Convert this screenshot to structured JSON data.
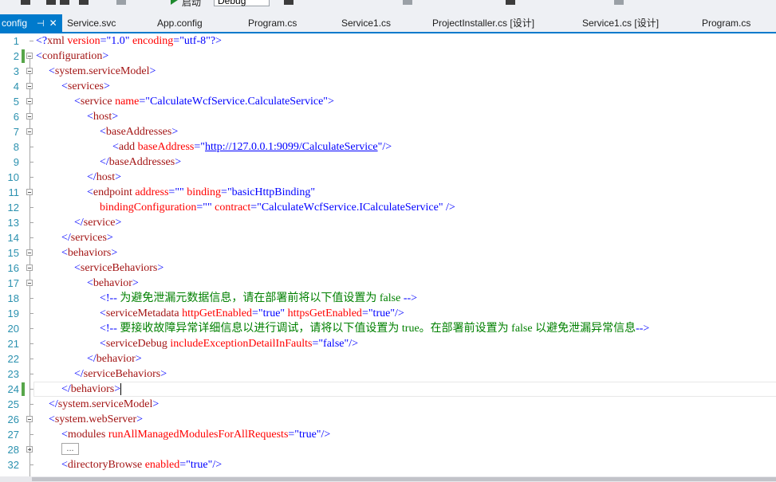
{
  "toolbar": {
    "start_label": "启动",
    "config_value": "Debug"
  },
  "tabs": [
    {
      "label": "config",
      "active": true,
      "pin": "⊣",
      "close": "✕"
    },
    {
      "label": "Service.svc"
    },
    {
      "label": "App.config"
    },
    {
      "label": "Program.cs"
    },
    {
      "label": "Service1.cs"
    },
    {
      "label": "ProjectInstaller.cs [设计]"
    },
    {
      "label": "Service1.cs [设计]"
    },
    {
      "label": "Program.cs"
    }
  ],
  "collapsed_label": "...",
  "lines": [
    {
      "no": "1",
      "indent": 0,
      "tokens": [
        [
          "b",
          "<?"
        ],
        [
          "m",
          "xml"
        ],
        [
          "r",
          " version"
        ],
        [
          "b",
          "="
        ],
        [
          "q",
          "\"1.0\""
        ],
        [
          "r",
          " encoding"
        ],
        [
          "b",
          "="
        ],
        [
          "q",
          "\"utf-8\""
        ],
        [
          "b",
          "?>"
        ]
      ]
    },
    {
      "no": "2",
      "indent": 0,
      "tokens": [
        [
          "b",
          "<"
        ],
        [
          "m",
          "configuration"
        ],
        [
          "b",
          ">"
        ]
      ]
    },
    {
      "no": "3",
      "indent": 1,
      "tokens": [
        [
          "b",
          "<"
        ],
        [
          "m",
          "system.serviceModel"
        ],
        [
          "b",
          ">"
        ]
      ]
    },
    {
      "no": "4",
      "indent": 2,
      "tokens": [
        [
          "b",
          "<"
        ],
        [
          "m",
          "services"
        ],
        [
          "b",
          ">"
        ]
      ]
    },
    {
      "no": "5",
      "indent": 3,
      "tokens": [
        [
          "b",
          "<"
        ],
        [
          "m",
          "service"
        ],
        [
          "r",
          " name"
        ],
        [
          "b",
          "="
        ],
        [
          "q",
          "\"CalculateWcfService.CalculateService\""
        ],
        [
          "b",
          ">"
        ]
      ]
    },
    {
      "no": "6",
      "indent": 4,
      "tokens": [
        [
          "b",
          "<"
        ],
        [
          "m",
          "host"
        ],
        [
          "b",
          ">"
        ]
      ]
    },
    {
      "no": "7",
      "indent": 5,
      "tokens": [
        [
          "b",
          "<"
        ],
        [
          "m",
          "baseAddresses"
        ],
        [
          "b",
          ">"
        ]
      ]
    },
    {
      "no": "8",
      "indent": 6,
      "tokens": [
        [
          "b",
          "<"
        ],
        [
          "m",
          "add"
        ],
        [
          "r",
          " baseAddress"
        ],
        [
          "b",
          "="
        ],
        [
          "b",
          "\""
        ],
        [
          "u",
          "http://127.0.0.1:9099/CalculateService"
        ],
        [
          "b",
          "\""
        ],
        [
          "b",
          "/>"
        ]
      ]
    },
    {
      "no": "9",
      "indent": 5,
      "tokens": [
        [
          "b",
          "</"
        ],
        [
          "m",
          "baseAddresses"
        ],
        [
          "b",
          ">"
        ]
      ]
    },
    {
      "no": "10",
      "indent": 4,
      "tokens": [
        [
          "b",
          "</"
        ],
        [
          "m",
          "host"
        ],
        [
          "b",
          ">"
        ]
      ]
    },
    {
      "no": "11",
      "indent": 4,
      "tokens": [
        [
          "b",
          "<"
        ],
        [
          "m",
          "endpoint"
        ],
        [
          "r",
          " address"
        ],
        [
          "b",
          "="
        ],
        [
          "q",
          "\"\""
        ],
        [
          "r",
          " binding"
        ],
        [
          "b",
          "="
        ],
        [
          "q",
          "\"basicHttpBinding\""
        ]
      ]
    },
    {
      "no": "12",
      "indent": 5,
      "tokens": [
        [
          "r",
          "bindingConfiguration"
        ],
        [
          "b",
          "="
        ],
        [
          "q",
          "\"\""
        ],
        [
          "r",
          " contract"
        ],
        [
          "b",
          "="
        ],
        [
          "q",
          "\"CalculateWcfService.ICalculateService\""
        ],
        [
          "b",
          " />"
        ]
      ]
    },
    {
      "no": "13",
      "indent": 3,
      "tokens": [
        [
          "b",
          "</"
        ],
        [
          "m",
          "service"
        ],
        [
          "b",
          ">"
        ]
      ]
    },
    {
      "no": "14",
      "indent": 2,
      "tokens": [
        [
          "b",
          "</"
        ],
        [
          "m",
          "services"
        ],
        [
          "b",
          ">"
        ]
      ]
    },
    {
      "no": "15",
      "indent": 2,
      "tokens": [
        [
          "b",
          "<"
        ],
        [
          "m",
          "behaviors"
        ],
        [
          "b",
          ">"
        ]
      ]
    },
    {
      "no": "16",
      "indent": 3,
      "tokens": [
        [
          "b",
          "<"
        ],
        [
          "m",
          "serviceBehaviors"
        ],
        [
          "b",
          ">"
        ]
      ]
    },
    {
      "no": "17",
      "indent": 4,
      "tokens": [
        [
          "b",
          "<"
        ],
        [
          "m",
          "behavior"
        ],
        [
          "b",
          ">"
        ]
      ]
    },
    {
      "no": "18",
      "indent": 5,
      "tokens": [
        [
          "b",
          "<!--"
        ],
        [
          "c",
          " 为避免泄漏元数据信息，请在部署前将以下值设置为 false "
        ],
        [
          "b",
          "-->"
        ]
      ]
    },
    {
      "no": "19",
      "indent": 5,
      "tokens": [
        [
          "b",
          "<"
        ],
        [
          "m",
          "serviceMetadata"
        ],
        [
          "r",
          " httpGetEnabled"
        ],
        [
          "b",
          "="
        ],
        [
          "q",
          "\"true\""
        ],
        [
          "r",
          " httpsGetEnabled"
        ],
        [
          "b",
          "="
        ],
        [
          "q",
          "\"true\""
        ],
        [
          "b",
          "/>"
        ]
      ]
    },
    {
      "no": "20",
      "indent": 5,
      "tokens": [
        [
          "b",
          "<!--"
        ],
        [
          "c",
          " 要接收故障异常详细信息以进行调试，请将以下值设置为 true。在部署前设置为 false 以避免泄漏异常信息"
        ],
        [
          "b",
          "-->"
        ]
      ]
    },
    {
      "no": "21",
      "indent": 5,
      "tokens": [
        [
          "b",
          "<"
        ],
        [
          "m",
          "serviceDebug"
        ],
        [
          "r",
          " includeExceptionDetailInFaults"
        ],
        [
          "b",
          "="
        ],
        [
          "q",
          "\"false\""
        ],
        [
          "b",
          "/>"
        ]
      ]
    },
    {
      "no": "22",
      "indent": 4,
      "tokens": [
        [
          "b",
          "</"
        ],
        [
          "m",
          "behavior"
        ],
        [
          "b",
          ">"
        ]
      ]
    },
    {
      "no": "23",
      "indent": 3,
      "tokens": [
        [
          "b",
          "</"
        ],
        [
          "m",
          "serviceBehaviors"
        ],
        [
          "b",
          ">"
        ]
      ]
    },
    {
      "no": "24",
      "indent": 2,
      "tokens": [
        [
          "b",
          "</"
        ],
        [
          "m",
          "behaviors"
        ],
        [
          "b",
          ">"
        ]
      ]
    },
    {
      "no": "25",
      "indent": 1,
      "tokens": [
        [
          "b",
          "</"
        ],
        [
          "m",
          "system.serviceModel"
        ],
        [
          "b",
          ">"
        ]
      ]
    },
    {
      "no": "26",
      "indent": 1,
      "tokens": [
        [
          "b",
          "<"
        ],
        [
          "m",
          "system.webServer"
        ],
        [
          "b",
          ">"
        ]
      ]
    },
    {
      "no": "27",
      "indent": 2,
      "tokens": [
        [
          "b",
          "<"
        ],
        [
          "m",
          "modules"
        ],
        [
          "r",
          " runAllManagedModulesForAllRequests"
        ],
        [
          "b",
          "="
        ],
        [
          "q",
          "\"true\""
        ],
        [
          "b",
          "/>"
        ]
      ]
    },
    {
      "no": "28",
      "indent": 2,
      "tokens": []
    },
    {
      "no": "32",
      "indent": 2,
      "tokens": [
        [
          "b",
          "<"
        ],
        [
          "m",
          "directoryBrowse"
        ],
        [
          "r",
          " enabled"
        ],
        [
          "b",
          "="
        ],
        [
          "q",
          "\"true\""
        ],
        [
          "b",
          "/>"
        ]
      ]
    }
  ]
}
